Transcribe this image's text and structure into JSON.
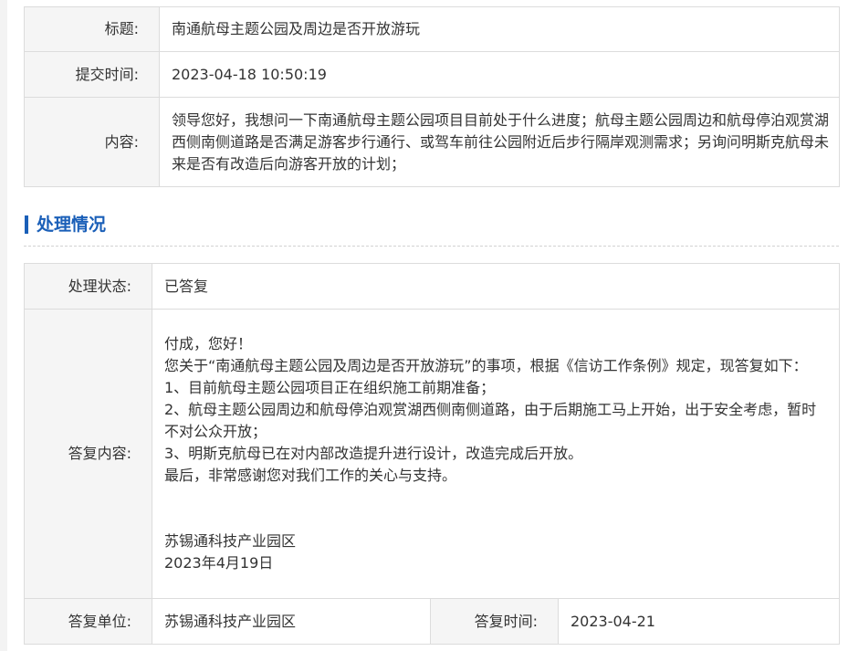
{
  "question": {
    "title_label": "标题:",
    "title_value": "南通航母主题公园及周边是否开放游玩",
    "time_label": "提交时间:",
    "time_value": "2023-04-18 10:50:19",
    "content_label": "内容:",
    "content_value": "领导您好，我想问一下南通航母主题公园项目目前处于什么进度；航母主题公园周边和航母停泊观赏湖西侧南侧道路是否满足游客步行通行、或驾车前往公园附近后步行隔岸观测需求；另询问明斯克航母未来是否有改造后向游客开放的计划；"
  },
  "section": {
    "title": "处理情况"
  },
  "handling": {
    "status_label": "处理状态:",
    "status_value": "已答复",
    "reply_label": "答复内容:",
    "reply_lines": [
      "付成，您好！",
      "您关于“南通航母主题公园及周边是否开放游玩”的事项，根据《信访工作条例》规定，现答复如下：",
      "1、目前航母主题公园项目正在组织施工前期准备；",
      "2、航母主题公园周边和航母停泊观赏湖西侧南侧道路，由于后期施工马上开始，出于安全考虑，暂时不对公众开放；",
      "3、明斯克航母已在对内部改造提升进行设计，改造完成后开放。",
      "最后，非常感谢您对我们工作的关心与支持。",
      "",
      "",
      "苏锡通科技产业园区",
      "2023年4月19日"
    ],
    "unit_label": "答复单位:",
    "unit_value": "苏锡通科技产业园区",
    "reply_time_label": "答复时间:",
    "reply_time_value": "2023-04-21"
  }
}
